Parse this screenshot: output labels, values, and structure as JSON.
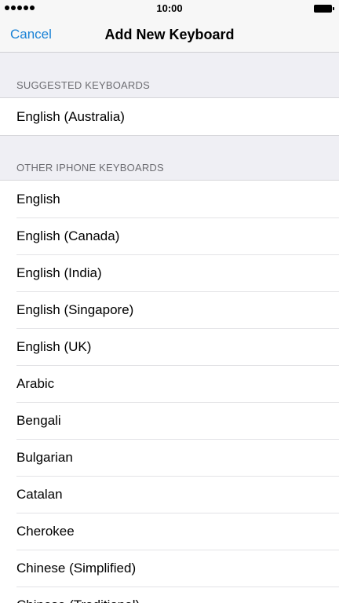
{
  "status": {
    "time": "10:00"
  },
  "nav": {
    "cancel_label": "Cancel",
    "title": "Add New Keyboard"
  },
  "suggested": {
    "header": "SUGGESTED KEYBOARDS",
    "items": [
      "English (Australia)"
    ]
  },
  "other": {
    "header": "OTHER IPHONE KEYBOARDS",
    "items": [
      "English",
      "English (Canada)",
      "English (India)",
      "English (Singapore)",
      "English (UK)",
      "Arabic",
      "Bengali",
      "Bulgarian",
      "Catalan",
      "Cherokee",
      "Chinese (Simplified)",
      "Chinese (Traditional)"
    ]
  },
  "colors": {
    "accent": "#1a82d6",
    "background": "#efeff4"
  }
}
